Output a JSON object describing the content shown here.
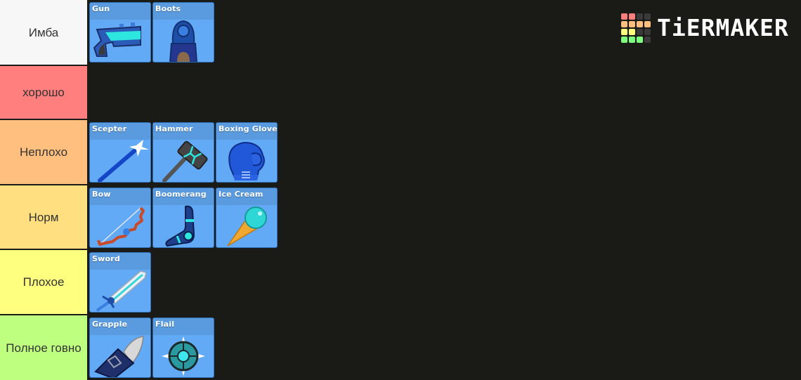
{
  "logo": {
    "text": "TiERMAKER",
    "grid_colors": [
      "#ff7f7f",
      "#ff7f7f",
      "#3a3a3a",
      "#3a3a3a",
      "#ffbf7f",
      "#ffbf7f",
      "#ffbf7f",
      "#ffbf7f",
      "#ffff7f",
      "#ffff7f",
      "#3a3a3a",
      "#3a3a3a",
      "#7fff7f",
      "#7fff7f",
      "#7fff7f",
      "#3a3a3a"
    ]
  },
  "tiers": [
    {
      "label": "Имба",
      "color": "#f7f7f7",
      "items": [
        {
          "name": "Gun",
          "icon": "gun"
        },
        {
          "name": "Boots",
          "icon": "boots"
        }
      ]
    },
    {
      "label": "хорошо",
      "color": "#ff7f7f",
      "items": []
    },
    {
      "label": "Неплохо",
      "color": "#ffbf7f",
      "items": [
        {
          "name": "Scepter",
          "icon": "scepter"
        },
        {
          "name": "Hammer",
          "icon": "hammer"
        },
        {
          "name": "Boxing Gloves",
          "icon": "boxing-gloves"
        }
      ]
    },
    {
      "label": "Норм",
      "color": "#ffdf7f",
      "items": [
        {
          "name": "Bow",
          "icon": "bow"
        },
        {
          "name": "Boomerang",
          "icon": "boomerang"
        },
        {
          "name": "Ice Cream",
          "icon": "ice-cream"
        }
      ]
    },
    {
      "label": "Плохое",
      "color": "#ffff7f",
      "items": [
        {
          "name": "Sword",
          "icon": "sword"
        }
      ]
    },
    {
      "label": "Полное говно",
      "color": "#bfff7f",
      "items": [
        {
          "name": "Grapple",
          "icon": "grapple"
        },
        {
          "name": "Flail",
          "icon": "flail"
        }
      ]
    }
  ]
}
